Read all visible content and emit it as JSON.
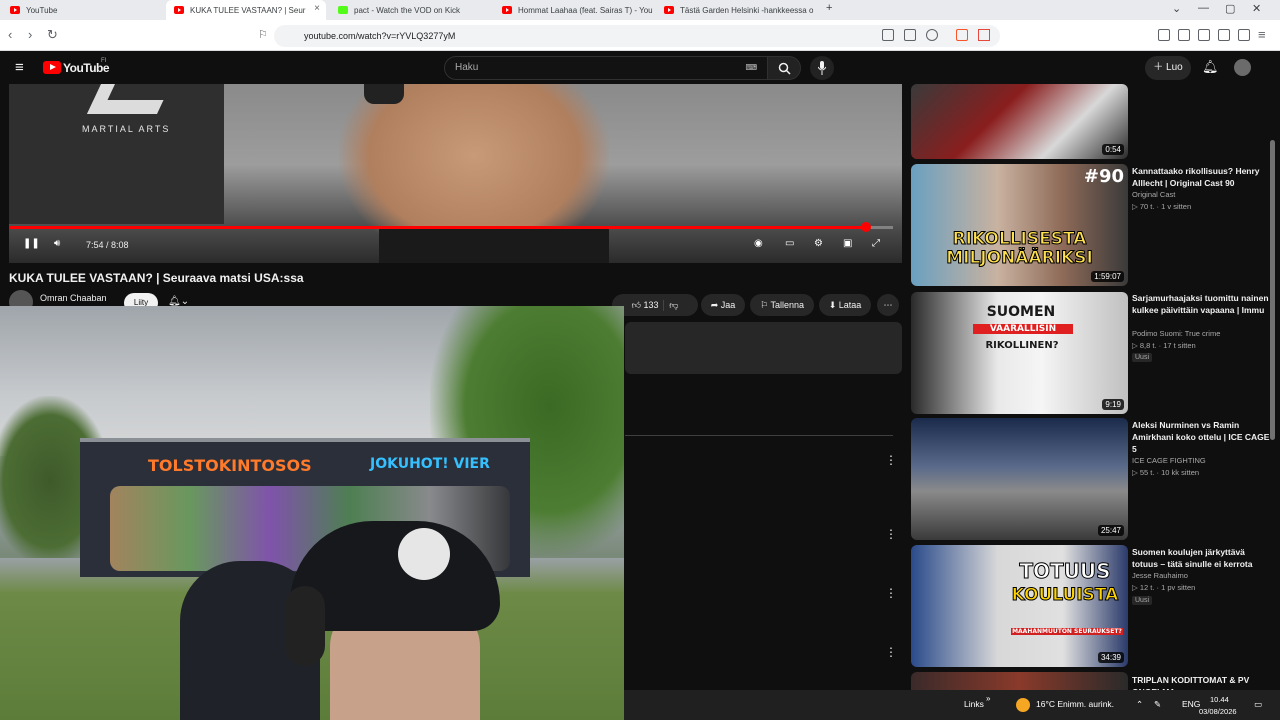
{
  "browser": {
    "tabs": [
      {
        "title": "YouTube",
        "favicon": "youtube-icon"
      },
      {
        "title": "KUKA TULEE VASTAAN? | Seur",
        "favicon": "youtube-icon",
        "active": true
      },
      {
        "title": "pact - Watch the VOD on Kick",
        "favicon": "kick-icon"
      },
      {
        "title": "Hommat Laahaa (feat. Sairas T) - You",
        "favicon": "youtube-icon"
      },
      {
        "title": "Tästä Garden Helsinki -hankkeessa o",
        "favicon": "youtube-icon"
      }
    ],
    "new_tab": "+",
    "url": "youtube.com/watch?v=rYVLQ3277yM"
  },
  "masthead": {
    "logo": "YouTube",
    "logo_region": "FI",
    "search_placeholder": "Haku",
    "create_label": "Luo"
  },
  "player": {
    "time": "7:54 / 8:08",
    "progress": 0.97,
    "backdrop_text": "MARTIAL ARTS"
  },
  "video": {
    "title": "KUKA TULEE VASTAAN? | Seuraava matsi USA:ssa",
    "channel": "Omran Chaaban",
    "join_label": "Liity",
    "likes": "133",
    "share_label": "Jaa",
    "save_label": "Tallenna",
    "download_label": "Lataa"
  },
  "webcam": {
    "mural_left": "TOLSTOKINTOSOS",
    "mural_right": "JOKUHOT! VIER"
  },
  "sidebar": {
    "items": [
      {
        "title": "",
        "channel": "",
        "meta": "",
        "duration": "0:54",
        "badge": ""
      },
      {
        "title": "Kannattaako rikollisuus? Henry Alllecht | Original Cast 90",
        "channel": "Original Cast",
        "meta": "▷ 70 t. · 1 v sitten",
        "duration": "1:59:07",
        "badge": "",
        "thumb_text_top": "#90",
        "thumb_text_bottom": "RIKOLLISESTA MILJONÄÄRIKSI"
      },
      {
        "title": "Sarjamurhaajaksi tuomittu nainen kulkee päivittäin vapaana | Immu",
        "channel": "Podimo Suomi: True crime",
        "meta": "▷ 8,8 t. · 17 t sitten",
        "duration": "9:19",
        "badge": "Uusi",
        "thumb_text_top": "SUOMEN",
        "thumb_text_mid": "VAARALLISIN",
        "thumb_text_bottom": "RIKOLLINEN?"
      },
      {
        "title": "Aleksi Nurminen vs Ramin Amirkhani koko ottelu | ICE CAGE 5",
        "channel": "ICE CAGE FIGHTING",
        "meta": "▷ 55 t. · 10 kk sitten",
        "duration": "25:47",
        "badge": ""
      },
      {
        "title": "Suomen koulujen järkyttävä totuus – tätä sinulle ei kerrota",
        "channel": "Jesse Rauhaimo",
        "meta": "▷ 12 t. · 1 pv sitten",
        "duration": "34:39",
        "badge": "Uusi",
        "thumb_text_top": "TOTUUS",
        "thumb_text_mid": "KOULUISTA",
        "thumb_text_bottom": "MAAHANMUUTON SEURAUKSET?"
      },
      {
        "title": "TRIPLAN KODITTOMAT & PV ONGELMA",
        "channel": "",
        "meta": "",
        "duration": "",
        "badge": ""
      }
    ]
  },
  "taskbar": {
    "links": "Links",
    "weather": "16°C  Enimm. aurink.",
    "lang": "ENG",
    "time": "10.44",
    "date": "03/08/2026"
  },
  "colors": {
    "yt_red": "#ff0000",
    "bg": "#0f0f0f",
    "kick_green": "#53fc18"
  }
}
